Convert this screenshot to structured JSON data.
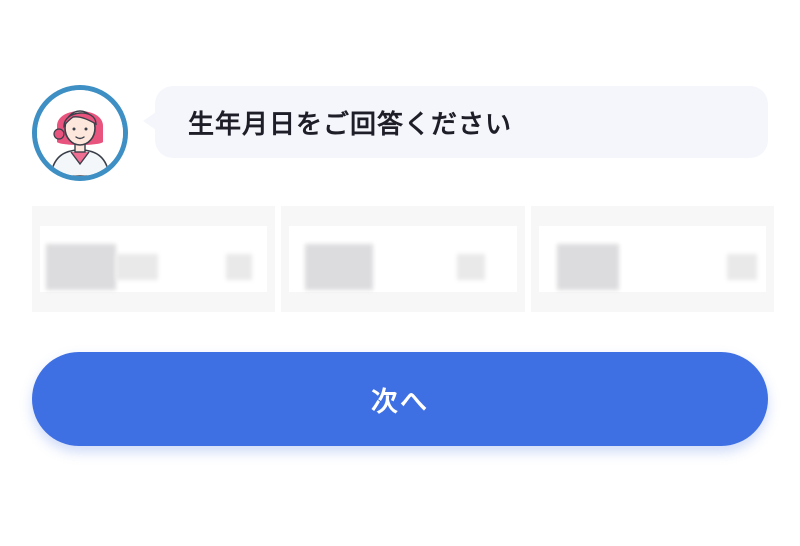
{
  "question": {
    "text": "生年月日をご回答ください"
  },
  "birthdate": {
    "fields": [
      {
        "name": "year",
        "value": ""
      },
      {
        "name": "month",
        "value": ""
      },
      {
        "name": "day",
        "value": ""
      }
    ]
  },
  "actions": {
    "next_label": "次へ"
  },
  "colors": {
    "button": "#3e6fe3",
    "bubble": "#f5f6fb",
    "avatar_ring": "#3d8fc4"
  },
  "icons": {
    "avatar": "nurse-avatar-icon"
  }
}
